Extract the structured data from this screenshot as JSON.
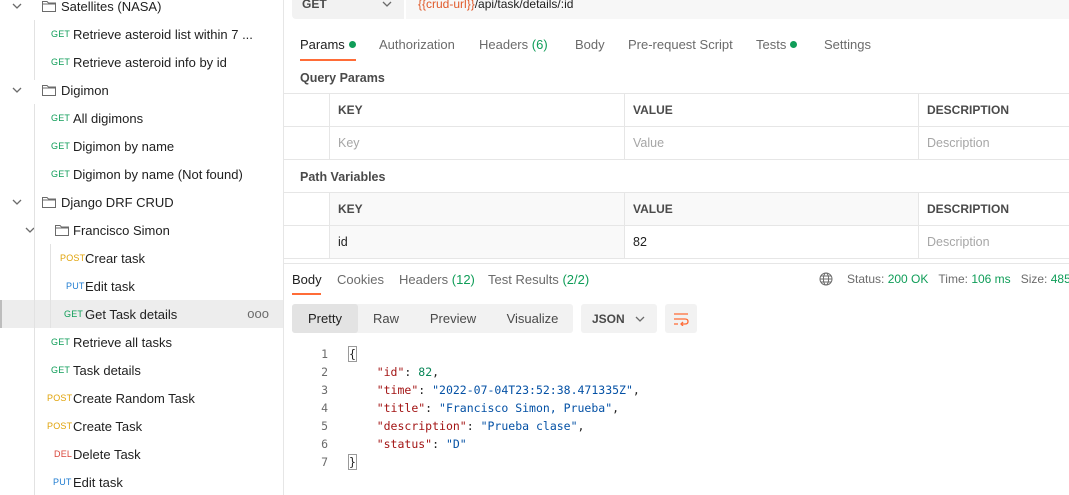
{
  "sidebar": {
    "items": [
      {
        "type": "folder",
        "label": "Satellites (NASA)"
      },
      {
        "type": "request",
        "method": "GET",
        "label": "Retrieve asteroid list within 7 ..."
      },
      {
        "type": "request",
        "method": "GET",
        "label": "Retrieve asteroid info by id"
      },
      {
        "type": "folder",
        "label": "Digimon"
      },
      {
        "type": "request",
        "method": "GET",
        "label": "All digimons"
      },
      {
        "type": "request",
        "method": "GET",
        "label": "Digimon by name"
      },
      {
        "type": "request",
        "method": "GET",
        "label": "Digimon by name (Not found)"
      },
      {
        "type": "folder",
        "label": "Django DRF CRUD"
      },
      {
        "type": "folder",
        "label": "Francisco Simon"
      },
      {
        "type": "request",
        "method": "POST",
        "label": "Crear task"
      },
      {
        "type": "request",
        "method": "PUT",
        "label": "Edit task"
      },
      {
        "type": "request",
        "method": "GET",
        "label": "Get Task details",
        "selected": true,
        "more": "ooo"
      },
      {
        "type": "request",
        "method": "GET",
        "label": "Retrieve all tasks"
      },
      {
        "type": "request",
        "method": "GET",
        "label": "Task details"
      },
      {
        "type": "request",
        "method": "POST",
        "label": "Create Random Task"
      },
      {
        "type": "request",
        "method": "POST",
        "label": "Create Task"
      },
      {
        "type": "request",
        "method": "DEL",
        "label": "Delete Task"
      },
      {
        "type": "request",
        "method": "PUT",
        "label": "Edit task"
      }
    ]
  },
  "request": {
    "method": "GET",
    "url_var": "{{crud-url}}",
    "url_rest": "/api/task/details/:id"
  },
  "req_tabs": {
    "params": "Params",
    "authorization": "Authorization",
    "headers": "Headers",
    "headers_count": "(6)",
    "body": "Body",
    "prerequest": "Pre-request Script",
    "tests": "Tests",
    "settings": "Settings"
  },
  "query_params": {
    "title": "Query Params",
    "columns": [
      "KEY",
      "VALUE",
      "DESCRIPTION"
    ],
    "placeholders": [
      "Key",
      "Value",
      "Description"
    ]
  },
  "path_variables": {
    "title": "Path Variables",
    "columns": [
      "KEY",
      "VALUE",
      "DESCRIPTION"
    ],
    "rows": [
      {
        "key": "id",
        "value": "82",
        "description": "Description"
      }
    ]
  },
  "response": {
    "tabs": {
      "body": "Body",
      "cookies": "Cookies",
      "headers": "Headers",
      "headers_count": "(12)",
      "test_results": "Test Results",
      "test_results_count": "(2/2)"
    },
    "status_label": "Status:",
    "status_value": "200 OK",
    "time_label": "Time:",
    "time_value": "106 ms",
    "size_label": "Size:",
    "size_value": "485",
    "view_tabs": [
      "Pretty",
      "Raw",
      "Preview",
      "Visualize"
    ],
    "format": "JSON",
    "code_lines": [
      {
        "n": "1",
        "text": "{"
      },
      {
        "n": "2",
        "key": "\"id\"",
        "sep": ": ",
        "val": "82",
        "vtype": "num",
        "tail": ","
      },
      {
        "n": "3",
        "key": "\"time\"",
        "sep": ": ",
        "val": "\"2022-07-04T23:52:38.471335Z\"",
        "vtype": "str",
        "tail": ","
      },
      {
        "n": "4",
        "key": "\"title\"",
        "sep": ": ",
        "val": "\"Francisco Simon, Prueba\"",
        "vtype": "str",
        "tail": ","
      },
      {
        "n": "5",
        "key": "\"description\"",
        "sep": ": ",
        "val": "\"Prueba clase\"",
        "vtype": "str",
        "tail": ","
      },
      {
        "n": "6",
        "key": "\"status\"",
        "sep": ": ",
        "val": "\"D\"",
        "vtype": "str",
        "tail": ""
      },
      {
        "n": "7",
        "text": "}"
      }
    ]
  },
  "colors": {
    "accent": "#ff6c37",
    "get": "#0f9d58",
    "post": "#e0a30a",
    "put": "#1e7bd0",
    "delete": "#d9453a"
  }
}
